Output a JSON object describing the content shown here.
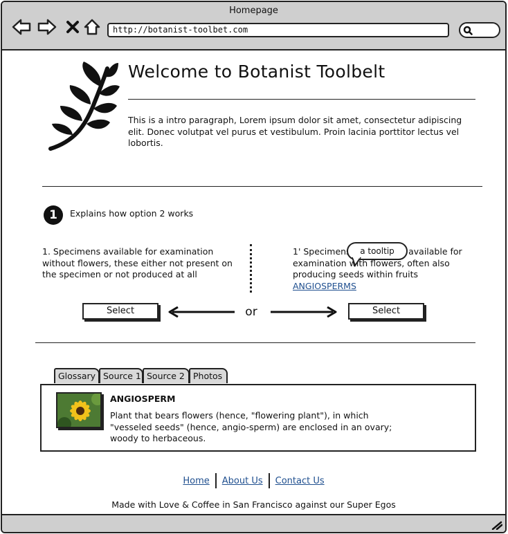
{
  "browser": {
    "title": "Homepage",
    "url": "http://botanist-toolbet.com",
    "nav_icons": [
      "back-arrow-icon",
      "forward-arrow-icon",
      "close-icon",
      "home-icon"
    ],
    "search_icon": "search-icon"
  },
  "header": {
    "heading": "Welcome to Botanist Toolbelt",
    "intro": "This is a intro paragraph, Lorem ipsum dolor sit amet, consectetur adipiscing elit. Donec volutpat vel purus et vestibulum. Proin lacinia porttitor lectus vel lobortis.",
    "logo_icon": "leaf-branch-icon"
  },
  "step": {
    "number": "1",
    "text": "Explains how option 2 works"
  },
  "options": {
    "left_text": "1. Specimens available for examination without flowers, these either not present on the specimen or not produced at all",
    "right_text": "1' Specimens with flowers available for examination with flowers, often also producing seeds within fruits",
    "right_link": "ANGIOSPERMS",
    "tooltip": "a tooltip",
    "select_left": "Select",
    "select_right": "Select",
    "or_label": "or"
  },
  "tabs": [
    "Glossary",
    "Source 1",
    "Source 2",
    "Photos"
  ],
  "glossary": {
    "term": "ANGIOSPERM",
    "definition": "Plant that bears flowers (hence, \"flowering plant\"), in which \"vesseled seeds\" (hence, angio-sperm) are enclosed in an ovary; woody to herbaceous."
  },
  "footer": {
    "links": [
      "Home",
      "About Us",
      "Contact Us"
    ],
    "note": "Made with Love & Coffee in San Francisco against our Super Egos"
  },
  "colors": {
    "chrome": "#cfcfcf",
    "link": "#1f4f8f",
    "ink": "#111111"
  }
}
